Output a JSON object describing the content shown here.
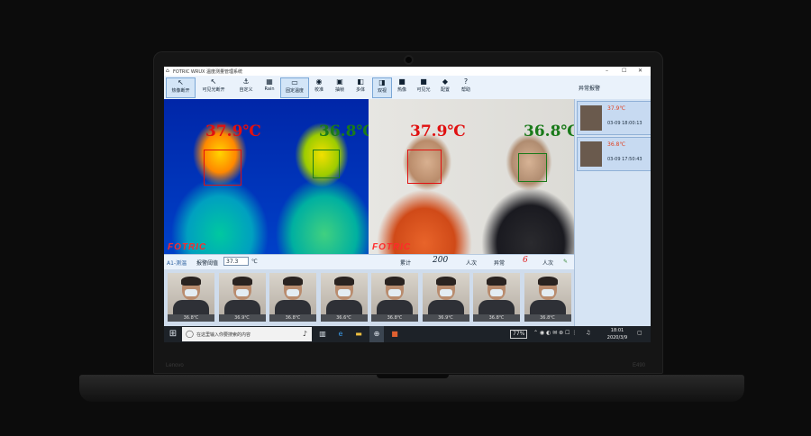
{
  "window": {
    "title": "FOTRIC WRUX 温度测量管理系统",
    "minimize": "–",
    "maximize": "☐",
    "close": "✕"
  },
  "toolbar": [
    {
      "label": "热像断开",
      "icon": "↖",
      "selected": true
    },
    {
      "label": "可见光断开",
      "icon": "↖",
      "selected": false
    },
    {
      "label": "自定义",
      "icon": "⚓",
      "selected": false
    },
    {
      "label": "Rain",
      "icon": "▦",
      "selected": false
    },
    {
      "label": "固定温度",
      "icon": "▭",
      "selected": true
    },
    {
      "label": "校准",
      "icon": "◉",
      "selected": false
    },
    {
      "label": "抽帧",
      "icon": "▣",
      "selected": false
    },
    {
      "label": "多体",
      "icon": "◧",
      "selected": false
    },
    {
      "label": "双视",
      "icon": "◨",
      "selected": true
    },
    {
      "label": "热像",
      "icon": "■",
      "selected": false
    },
    {
      "label": "可见光",
      "icon": "■",
      "selected": false
    },
    {
      "label": "配置",
      "icon": "◆",
      "selected": false
    },
    {
      "label": "帮助",
      "icon": "?",
      "selected": false
    }
  ],
  "side_panel": {
    "title": "异常报警",
    "alarms": [
      {
        "temp": "37.9℃",
        "time": "03-09 18:00:13"
      },
      {
        "temp": "36.8℃",
        "time": "03-09 17:50:43"
      }
    ]
  },
  "thermal_view": {
    "brand": "FOTRIC",
    "readings": [
      {
        "temp": "37.9℃",
        "color": "#e01010"
      },
      {
        "temp": "36.8℃",
        "color": "#1a7a1a"
      }
    ]
  },
  "visible_view": {
    "brand": "FOTRIC",
    "readings": [
      {
        "temp": "37.9℃",
        "color": "#e01010"
      },
      {
        "temp": "36.8℃",
        "color": "#1a7a1a"
      }
    ]
  },
  "status": {
    "mode": "A1-测温",
    "threshold_label": "报警阈值",
    "threshold_value": "37.3",
    "threshold_unit": "℃",
    "total_label": "累计",
    "total_count": "200",
    "total_unit": "人次",
    "abnormal_label": "异常",
    "abnormal_count": "6",
    "abnormal_unit": "人次"
  },
  "thumbnails": [
    "36.8℃",
    "36.9℃",
    "36.8℃",
    "36.6℃",
    "36.8℃",
    "36.9℃",
    "36.8℃",
    "36.8℃"
  ],
  "taskbar": {
    "search_placeholder": "在这里输入你要搜索的内容",
    "battery": "77%",
    "time": "18:01",
    "date": "2020/3/9"
  },
  "device": {
    "brand": "Lenovo",
    "model": "E490"
  }
}
